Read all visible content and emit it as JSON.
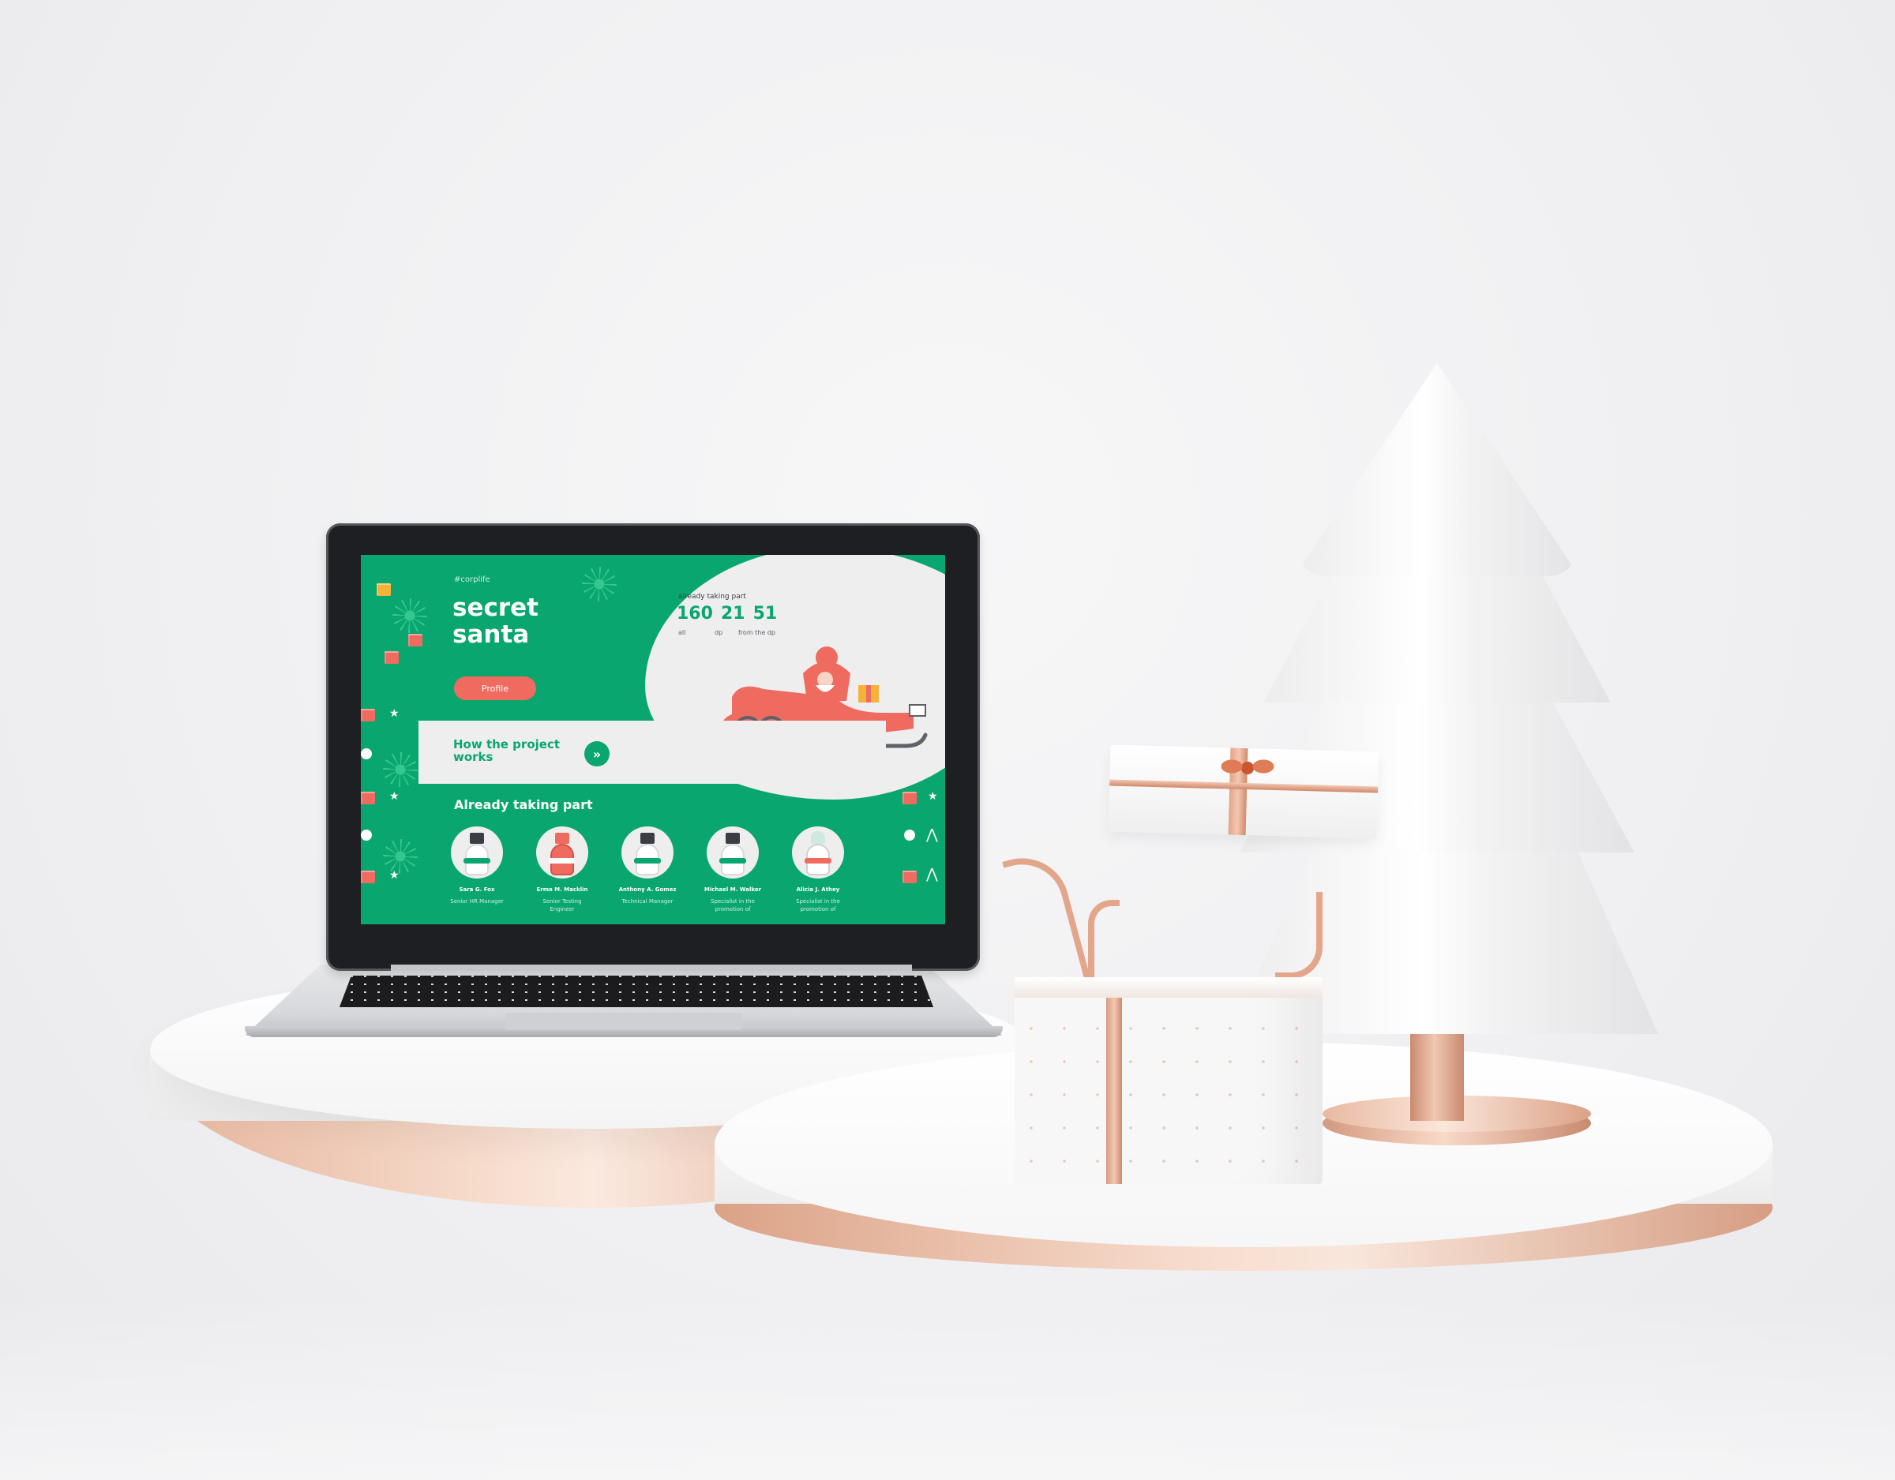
{
  "screen": {
    "tag": "#corplife",
    "title": "secret santa",
    "profile_button": "Profile",
    "stats": {
      "heading": "already taking part",
      "values": [
        "160",
        "21",
        "51"
      ],
      "labels": [
        "all",
        "dp",
        "from the dp"
      ]
    },
    "how_card": {
      "text": "How the project works",
      "arrow_glyph": "»"
    },
    "already_title": "Already taking part",
    "participants": [
      {
        "name": "Sara G. Fox",
        "role": "Senior HR Manager",
        "avatar": "snowman"
      },
      {
        "name": "Erma M. Macklin",
        "role": "Senior Testing Engineer",
        "avatar": "santa"
      },
      {
        "name": "Anthony A. Gomez",
        "role": "Technical Manager",
        "avatar": "snowman"
      },
      {
        "name": "Michael M. Walker",
        "role": "Specialist in the promotion of",
        "avatar": "snowman"
      },
      {
        "name": "Alicia J. Athey",
        "role": "Specialist in the promotion of",
        "avatar": "bunny"
      }
    ]
  },
  "colors": {
    "brand_green": "#0aa66f",
    "accent_coral": "#ef6a5f",
    "panel_light": "#eeeeef",
    "rose_gold": "#e4a68b"
  }
}
